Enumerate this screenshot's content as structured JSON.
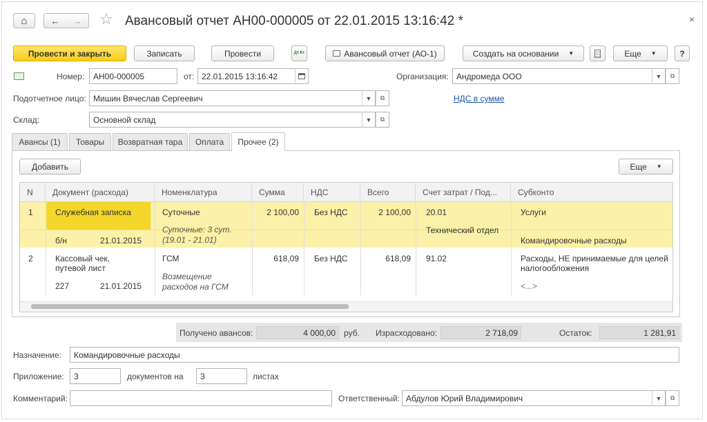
{
  "window": {
    "title": "Авансовый отчет АН00-000005 от 22.01.2015 13:16:42 *",
    "close_glyph": "×",
    "home_glyph": "⌂",
    "back_glyph": "←",
    "forward_glyph": "→",
    "star_glyph": "☆"
  },
  "toolbar": {
    "post_close": "Провести и закрыть",
    "save": "Записать",
    "post": "Провести",
    "dtkt_glyph": "Дт Кт",
    "print_report": "Авансовый отчет (АО-1)",
    "create_based": "Создать на основании",
    "more": "Еще",
    "help": "?"
  },
  "header": {
    "number_label": "Номер:",
    "number_value": "АН00-000005",
    "date_label": "от:",
    "date_value": "22.01.2015 13:16:42",
    "org_label": "Организация:",
    "org_value": "Андромеда ООО",
    "person_label": "Подотчетное лицо:",
    "person_value": "Мишин Вячеслав Сергеевич",
    "vat_link": "НДС в сумме",
    "warehouse_label": "Склад:",
    "warehouse_value": "Основной склад"
  },
  "tabs": [
    {
      "label": "Авансы (1)"
    },
    {
      "label": "Товары"
    },
    {
      "label": "Возвратная тара"
    },
    {
      "label": "Оплата"
    },
    {
      "label": "Прочее (2)"
    }
  ],
  "panel": {
    "add": "Добавить",
    "more": "Еще"
  },
  "grid": {
    "columns": [
      "N",
      "Документ (расхода)",
      "Номенклатура",
      "Сумма",
      "НДС",
      "Всего",
      "Счет затрат / Под...",
      "Субконто"
    ],
    "rows": [
      {
        "n": "1",
        "doc": "Служебная записка",
        "doc_num": "б/н",
        "doc_date": "21.01.2015",
        "item": "Суточные",
        "item_note_1": "Суточные: 3 сут.",
        "item_note_2": "(19.01 - 21.01)",
        "sum": "2 100,00",
        "vat": "Без НДС",
        "total": "2 100,00",
        "account": "20.01",
        "account_sub": "Технический отдел",
        "subconto_1": "Услуги",
        "subconto_2": "Командировочные расходы"
      },
      {
        "n": "2",
        "doc_1": "Кассовый чек,",
        "doc_2": "путевой лист",
        "doc_num": "227",
        "doc_date": "21.01.2015",
        "item": "ГСМ",
        "item_note_1": "Возмещение",
        "item_note_2": "расходов на ГСМ",
        "sum": "618,09",
        "vat": "Без НДС",
        "total": "618,09",
        "account": "91.02",
        "subconto_1": "Расходы, НЕ принимаемые для целей",
        "subconto_2": "налогообложения",
        "subconto_3": "<...>"
      }
    ]
  },
  "totals": {
    "received_label": "Получено авансов:",
    "received_value": "4 000,00",
    "currency": "руб.",
    "spent_label": "Израсходовано:",
    "spent_value": "2 718,09",
    "balance_label": "Остаток:",
    "balance_value": "1 281,91"
  },
  "footer": {
    "purpose_label": "Назначение:",
    "purpose_value": "Командировочные расходы",
    "attachment_label": "Приложение:",
    "attachment_docs": "3",
    "docs_on_label": "документов на",
    "attachment_sheets": "3",
    "sheets_label": "листах",
    "comment_label": "Комментарий:",
    "comment_value": "",
    "responsible_label": "Ответственный:",
    "responsible_value": "Абдулов Юрий Владимирович"
  },
  "colors": {
    "accent_yellow": "#f6cd18",
    "selected_row": "#fbf1a8",
    "selected_cell": "#f4d72a",
    "link": "#1a56a8"
  }
}
